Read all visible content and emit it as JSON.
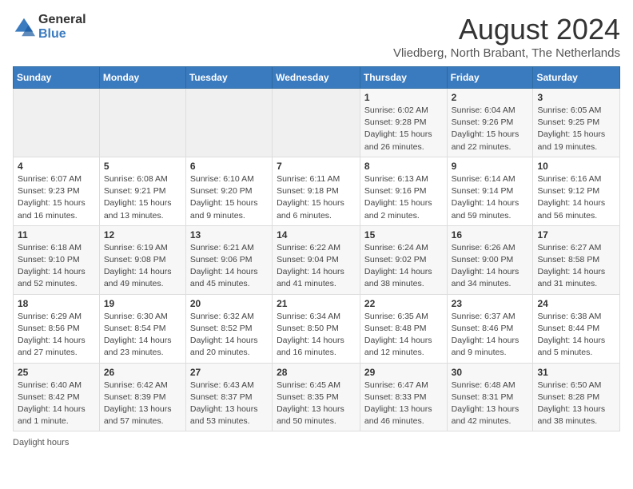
{
  "logo": {
    "general": "General",
    "blue": "Blue"
  },
  "header": {
    "month_year": "August 2024",
    "location": "Vliedberg, North Brabant, The Netherlands"
  },
  "days_of_week": [
    "Sunday",
    "Monday",
    "Tuesday",
    "Wednesday",
    "Thursday",
    "Friday",
    "Saturday"
  ],
  "weeks": [
    [
      {
        "num": "",
        "info": ""
      },
      {
        "num": "",
        "info": ""
      },
      {
        "num": "",
        "info": ""
      },
      {
        "num": "",
        "info": ""
      },
      {
        "num": "1",
        "info": "Sunrise: 6:02 AM\nSunset: 9:28 PM\nDaylight: 15 hours and 26 minutes."
      },
      {
        "num": "2",
        "info": "Sunrise: 6:04 AM\nSunset: 9:26 PM\nDaylight: 15 hours and 22 minutes."
      },
      {
        "num": "3",
        "info": "Sunrise: 6:05 AM\nSunset: 9:25 PM\nDaylight: 15 hours and 19 minutes."
      }
    ],
    [
      {
        "num": "4",
        "info": "Sunrise: 6:07 AM\nSunset: 9:23 PM\nDaylight: 15 hours and 16 minutes."
      },
      {
        "num": "5",
        "info": "Sunrise: 6:08 AM\nSunset: 9:21 PM\nDaylight: 15 hours and 13 minutes."
      },
      {
        "num": "6",
        "info": "Sunrise: 6:10 AM\nSunset: 9:20 PM\nDaylight: 15 hours and 9 minutes."
      },
      {
        "num": "7",
        "info": "Sunrise: 6:11 AM\nSunset: 9:18 PM\nDaylight: 15 hours and 6 minutes."
      },
      {
        "num": "8",
        "info": "Sunrise: 6:13 AM\nSunset: 9:16 PM\nDaylight: 15 hours and 2 minutes."
      },
      {
        "num": "9",
        "info": "Sunrise: 6:14 AM\nSunset: 9:14 PM\nDaylight: 14 hours and 59 minutes."
      },
      {
        "num": "10",
        "info": "Sunrise: 6:16 AM\nSunset: 9:12 PM\nDaylight: 14 hours and 56 minutes."
      }
    ],
    [
      {
        "num": "11",
        "info": "Sunrise: 6:18 AM\nSunset: 9:10 PM\nDaylight: 14 hours and 52 minutes."
      },
      {
        "num": "12",
        "info": "Sunrise: 6:19 AM\nSunset: 9:08 PM\nDaylight: 14 hours and 49 minutes."
      },
      {
        "num": "13",
        "info": "Sunrise: 6:21 AM\nSunset: 9:06 PM\nDaylight: 14 hours and 45 minutes."
      },
      {
        "num": "14",
        "info": "Sunrise: 6:22 AM\nSunset: 9:04 PM\nDaylight: 14 hours and 41 minutes."
      },
      {
        "num": "15",
        "info": "Sunrise: 6:24 AM\nSunset: 9:02 PM\nDaylight: 14 hours and 38 minutes."
      },
      {
        "num": "16",
        "info": "Sunrise: 6:26 AM\nSunset: 9:00 PM\nDaylight: 14 hours and 34 minutes."
      },
      {
        "num": "17",
        "info": "Sunrise: 6:27 AM\nSunset: 8:58 PM\nDaylight: 14 hours and 31 minutes."
      }
    ],
    [
      {
        "num": "18",
        "info": "Sunrise: 6:29 AM\nSunset: 8:56 PM\nDaylight: 14 hours and 27 minutes."
      },
      {
        "num": "19",
        "info": "Sunrise: 6:30 AM\nSunset: 8:54 PM\nDaylight: 14 hours and 23 minutes."
      },
      {
        "num": "20",
        "info": "Sunrise: 6:32 AM\nSunset: 8:52 PM\nDaylight: 14 hours and 20 minutes."
      },
      {
        "num": "21",
        "info": "Sunrise: 6:34 AM\nSunset: 8:50 PM\nDaylight: 14 hours and 16 minutes."
      },
      {
        "num": "22",
        "info": "Sunrise: 6:35 AM\nSunset: 8:48 PM\nDaylight: 14 hours and 12 minutes."
      },
      {
        "num": "23",
        "info": "Sunrise: 6:37 AM\nSunset: 8:46 PM\nDaylight: 14 hours and 9 minutes."
      },
      {
        "num": "24",
        "info": "Sunrise: 6:38 AM\nSunset: 8:44 PM\nDaylight: 14 hours and 5 minutes."
      }
    ],
    [
      {
        "num": "25",
        "info": "Sunrise: 6:40 AM\nSunset: 8:42 PM\nDaylight: 14 hours and 1 minute."
      },
      {
        "num": "26",
        "info": "Sunrise: 6:42 AM\nSunset: 8:39 PM\nDaylight: 13 hours and 57 minutes."
      },
      {
        "num": "27",
        "info": "Sunrise: 6:43 AM\nSunset: 8:37 PM\nDaylight: 13 hours and 53 minutes."
      },
      {
        "num": "28",
        "info": "Sunrise: 6:45 AM\nSunset: 8:35 PM\nDaylight: 13 hours and 50 minutes."
      },
      {
        "num": "29",
        "info": "Sunrise: 6:47 AM\nSunset: 8:33 PM\nDaylight: 13 hours and 46 minutes."
      },
      {
        "num": "30",
        "info": "Sunrise: 6:48 AM\nSunset: 8:31 PM\nDaylight: 13 hours and 42 minutes."
      },
      {
        "num": "31",
        "info": "Sunrise: 6:50 AM\nSunset: 8:28 PM\nDaylight: 13 hours and 38 minutes."
      }
    ]
  ],
  "footer": {
    "note": "Daylight hours"
  }
}
